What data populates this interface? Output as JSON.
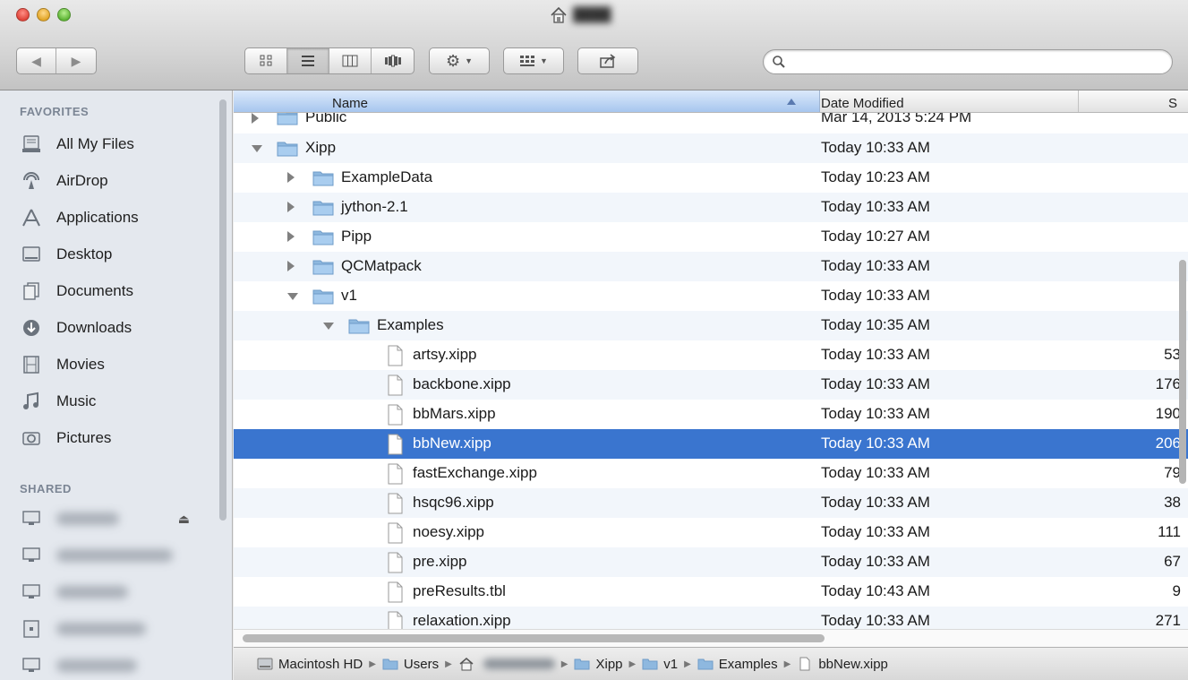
{
  "window": {
    "colors": {
      "selection": "#3a75cf",
      "sidebar_bg": "#e4e8ee",
      "header_sort": "#a7c6ee"
    }
  },
  "toolbar": {
    "back_icon": "back-arrow-icon",
    "forward_icon": "forward-arrow-icon",
    "view_modes": [
      "icon-view",
      "list-view",
      "column-view",
      "cover-flow-view"
    ],
    "active_view": "list-view",
    "search_placeholder": "",
    "search_value": ""
  },
  "sidebar": {
    "favorites_heading": "FAVORITES",
    "shared_heading": "SHARED",
    "favorites": [
      {
        "label": "All My Files",
        "icon": "all-my-files-icon"
      },
      {
        "label": "AirDrop",
        "icon": "airdrop-icon"
      },
      {
        "label": "Applications",
        "icon": "applications-icon"
      },
      {
        "label": "Desktop",
        "icon": "desktop-icon"
      },
      {
        "label": "Documents",
        "icon": "documents-icon"
      },
      {
        "label": "Downloads",
        "icon": "downloads-icon"
      },
      {
        "label": "Movies",
        "icon": "movies-icon"
      },
      {
        "label": "Music",
        "icon": "music-icon"
      },
      {
        "label": "Pictures",
        "icon": "pictures-icon"
      }
    ]
  },
  "columns": {
    "name": "Name",
    "date": "Date Modified",
    "size": "S"
  },
  "rows": [
    {
      "name": "Public",
      "date": "Mar 14, 2013 5:24 PM",
      "size": "",
      "level": 0,
      "kind": "folder",
      "state": "collapsed"
    },
    {
      "name": "Xipp",
      "date": "Today 10:33 AM",
      "size": "",
      "level": 0,
      "kind": "folder",
      "state": "expanded"
    },
    {
      "name": "ExampleData",
      "date": "Today 10:23 AM",
      "size": "",
      "level": 1,
      "kind": "folder",
      "state": "collapsed"
    },
    {
      "name": "jython-2.1",
      "date": "Today 10:33 AM",
      "size": "",
      "level": 1,
      "kind": "folder",
      "state": "collapsed"
    },
    {
      "name": "Pipp",
      "date": "Today 10:27 AM",
      "size": "",
      "level": 1,
      "kind": "folder",
      "state": "collapsed"
    },
    {
      "name": "QCMatpack",
      "date": "Today 10:33 AM",
      "size": "",
      "level": 1,
      "kind": "folder",
      "state": "collapsed"
    },
    {
      "name": "v1",
      "date": "Today 10:33 AM",
      "size": "",
      "level": 1,
      "kind": "folder",
      "state": "expanded"
    },
    {
      "name": "Examples",
      "date": "Today 10:35 AM",
      "size": "",
      "level": 2,
      "kind": "folder",
      "state": "expanded"
    },
    {
      "name": "artsy.xipp",
      "date": "Today 10:33 AM",
      "size": "53",
      "level": 3,
      "kind": "file"
    },
    {
      "name": "backbone.xipp",
      "date": "Today 10:33 AM",
      "size": "176",
      "level": 3,
      "kind": "file"
    },
    {
      "name": "bbMars.xipp",
      "date": "Today 10:33 AM",
      "size": "190",
      "level": 3,
      "kind": "file"
    },
    {
      "name": "bbNew.xipp",
      "date": "Today 10:33 AM",
      "size": "206",
      "level": 3,
      "kind": "file",
      "selected": true
    },
    {
      "name": "fastExchange.xipp",
      "date": "Today 10:33 AM",
      "size": "79",
      "level": 3,
      "kind": "file"
    },
    {
      "name": "hsqc96.xipp",
      "date": "Today 10:33 AM",
      "size": "38",
      "level": 3,
      "kind": "file"
    },
    {
      "name": "noesy.xipp",
      "date": "Today 10:33 AM",
      "size": "111",
      "level": 3,
      "kind": "file"
    },
    {
      "name": "pre.xipp",
      "date": "Today 10:33 AM",
      "size": "67",
      "level": 3,
      "kind": "file"
    },
    {
      "name": "preResults.tbl",
      "date": "Today 10:43 AM",
      "size": "9",
      "level": 3,
      "kind": "file"
    },
    {
      "name": "relaxation.xipp",
      "date": "Today 10:33 AM",
      "size": "271",
      "level": 3,
      "kind": "file"
    }
  ],
  "pathbar": [
    {
      "label": "Macintosh HD",
      "icon": "hard-drive-icon"
    },
    {
      "label": "Users",
      "icon": "folder-icon"
    },
    {
      "label": "",
      "icon": "home-icon"
    },
    {
      "label": "Xipp",
      "icon": "folder-icon"
    },
    {
      "label": "v1",
      "icon": "folder-icon"
    },
    {
      "label": "Examples",
      "icon": "folder-icon"
    },
    {
      "label": "bbNew.xipp",
      "icon": "document-icon"
    }
  ]
}
